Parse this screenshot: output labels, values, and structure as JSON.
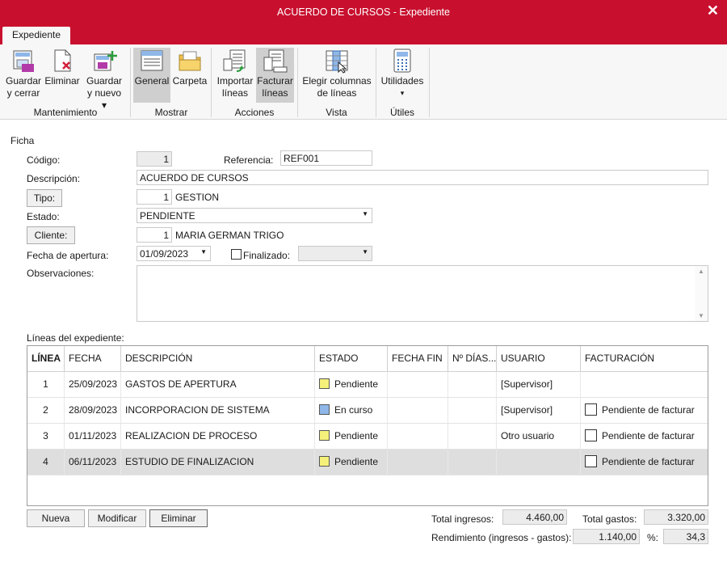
{
  "window": {
    "title": "ACUERDO DE CURSOS - Expediente",
    "close_glyph": "✕"
  },
  "ribbon": {
    "tab": "Expediente",
    "groups": {
      "mantenimiento": "Mantenimiento",
      "mostrar": "Mostrar",
      "acciones": "Acciones",
      "vista": "Vista",
      "utiles": "Útiles"
    },
    "buttons": {
      "guardar_cerrar": [
        "Guardar",
        "y cerrar"
      ],
      "eliminar": "Eliminar",
      "guardar_nuevo": [
        "Guardar",
        "y nuevo ▾"
      ],
      "general": "General",
      "carpeta": "Carpeta",
      "importar_lineas": [
        "Importar",
        "líneas"
      ],
      "facturar_lineas": [
        "Facturar",
        "líneas"
      ],
      "elegir_columnas": [
        "Elegir columnas",
        "de líneas"
      ],
      "utilidades": [
        "Utilidades",
        "▾"
      ]
    }
  },
  "ficha": {
    "section_title": "Ficha",
    "codigo_label": "Código:",
    "codigo_value": "1",
    "referencia_label": "Referencia:",
    "referencia_value": "REF001",
    "descripcion_label": "Descripción:",
    "descripcion_value": "ACUERDO DE CURSOS",
    "tipo_button": "Tipo:",
    "tipo_code": "1",
    "tipo_name": "GESTION",
    "estado_label": "Estado:",
    "estado_value": "PENDIENTE",
    "cliente_button": "Cliente:",
    "cliente_code": "1",
    "cliente_name": "MARIA GERMAN TRIGO",
    "fecha_apertura_label": "Fecha de apertura:",
    "fecha_apertura_value": "01/09/2023",
    "finalizado_label": "Finalizado:",
    "finalizado_checked": false,
    "finalizado_value": "",
    "observaciones_label": "Observaciones:",
    "observaciones_value": ""
  },
  "lineas": {
    "section_title": "Líneas del expediente:",
    "columns": [
      "LÍNEA",
      "FECHA",
      "DESCRIPCIÓN",
      "ESTADO",
      "FECHA FIN",
      "Nº DÍAS...",
      "USUARIO",
      "FACTURACIÓN"
    ],
    "rows": [
      {
        "linea": "1",
        "fecha": "25/09/2023",
        "descripcion": "GASTOS DE APERTURA",
        "estado": "Pendiente",
        "estado_color": "#f5f07a",
        "fecha_fin": "",
        "dias": "",
        "usuario": "[Supervisor]",
        "facturacion": "",
        "selected": false
      },
      {
        "linea": "2",
        "fecha": "28/09/2023",
        "descripcion": "INCORPORACION DE SISTEMA",
        "estado": "En curso",
        "estado_color": "#8fb7e8",
        "fecha_fin": "",
        "dias": "",
        "usuario": "[Supervisor]",
        "facturacion": "Pendiente de facturar",
        "selected": false
      },
      {
        "linea": "3",
        "fecha": "01/11/2023",
        "descripcion": "REALIZACION DE PROCESO",
        "estado": "Pendiente",
        "estado_color": "#f5f07a",
        "fecha_fin": "",
        "dias": "",
        "usuario": "Otro usuario",
        "facturacion": "Pendiente de facturar",
        "selected": false
      },
      {
        "linea": "4",
        "fecha": "06/11/2023",
        "descripcion": "ESTUDIO DE FINALIZACION",
        "estado": "Pendiente",
        "estado_color": "#f5f07a",
        "fecha_fin": "",
        "dias": "",
        "usuario": "",
        "facturacion": "Pendiente de facturar",
        "selected": true
      }
    ]
  },
  "actions": {
    "nueva": "Nueva",
    "modificar": "Modificar",
    "eliminar": "Eliminar"
  },
  "totals": {
    "ingresos_label": "Total ingresos:",
    "ingresos_value": "4.460,00",
    "gastos_label": "Total gastos:",
    "gastos_value": "3.320,00",
    "rendimiento_label": "Rendimiento (ingresos - gastos):",
    "rendimiento_value": "1.140,00",
    "pct_label": "%:",
    "pct_value": "34,3"
  },
  "colors": {
    "titlebar": "#c8102e",
    "ribbon_bg": "#f7f7f7",
    "selected_row": "#dedede"
  },
  "icons": [
    "save-close-icon",
    "delete-icon",
    "save-new-icon",
    "general-view-icon",
    "folder-icon",
    "import-lines-icon",
    "invoice-lines-icon",
    "choose-columns-icon",
    "calculator-icon"
  ]
}
